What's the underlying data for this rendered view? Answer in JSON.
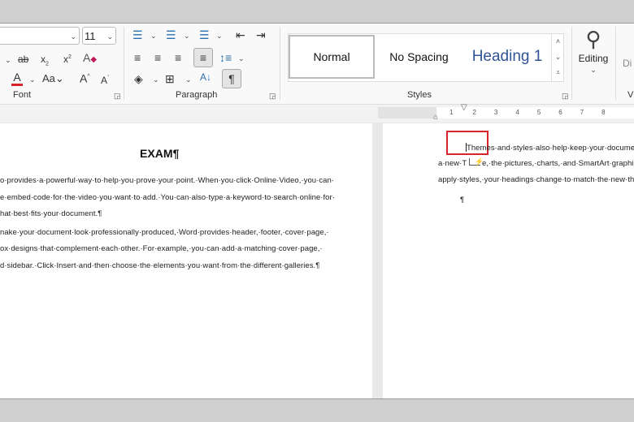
{
  "ribbon": {
    "font_size": "11",
    "font_group_label": "Font",
    "paragraph_group_label": "Paragraph",
    "styles_group_label": "Styles",
    "styles": [
      "Normal",
      "No Spacing",
      "Heading 1"
    ],
    "editing_label": "Editing",
    "cut_off_label": "Di",
    "cut_off_group": "V"
  },
  "ruler": {
    "ticks": [
      "1",
      "2",
      "3",
      "4",
      "5",
      "6",
      "7",
      "8"
    ]
  },
  "left_page": {
    "title": "EXAM¶",
    "lines": [
      "o·provides·a·powerful·way·to·help·you·prove·your·point.·When·you·click·Online·Video,·you·can·",
      "e·embed·code·for·the·video·you·want·to·add.·You·can·also·type·a·keyword·to·search·online·for·",
      "hat·best·fits·your·document.¶",
      "nake·your·document·look·professionally·produced,·Word·provides·header,·footer,·cover·page,·",
      "ox·designs·that·complement·each·other.·For·example,·you·can·add·a·matching·cover·page,·",
      "d·sidebar.·Click·Insert·and·then·choose·the·elements·you·want·from·the·different·galleries.¶"
    ]
  },
  "right_page": {
    "lines": [
      "Themes·and·styles·also·help·keep·your·documen",
      "a·new·T",
      "e,·the·pictures,·charts,·and·SmartArt·graphi",
      "apply·styles,·your·headings·change·to·match·the·new·th"
    ],
    "pilcrow": "¶",
    "highlight_color": "#d9232d"
  },
  "colors": {
    "font_color_bar": "#d9232d",
    "heading_color": "#2f5496"
  }
}
